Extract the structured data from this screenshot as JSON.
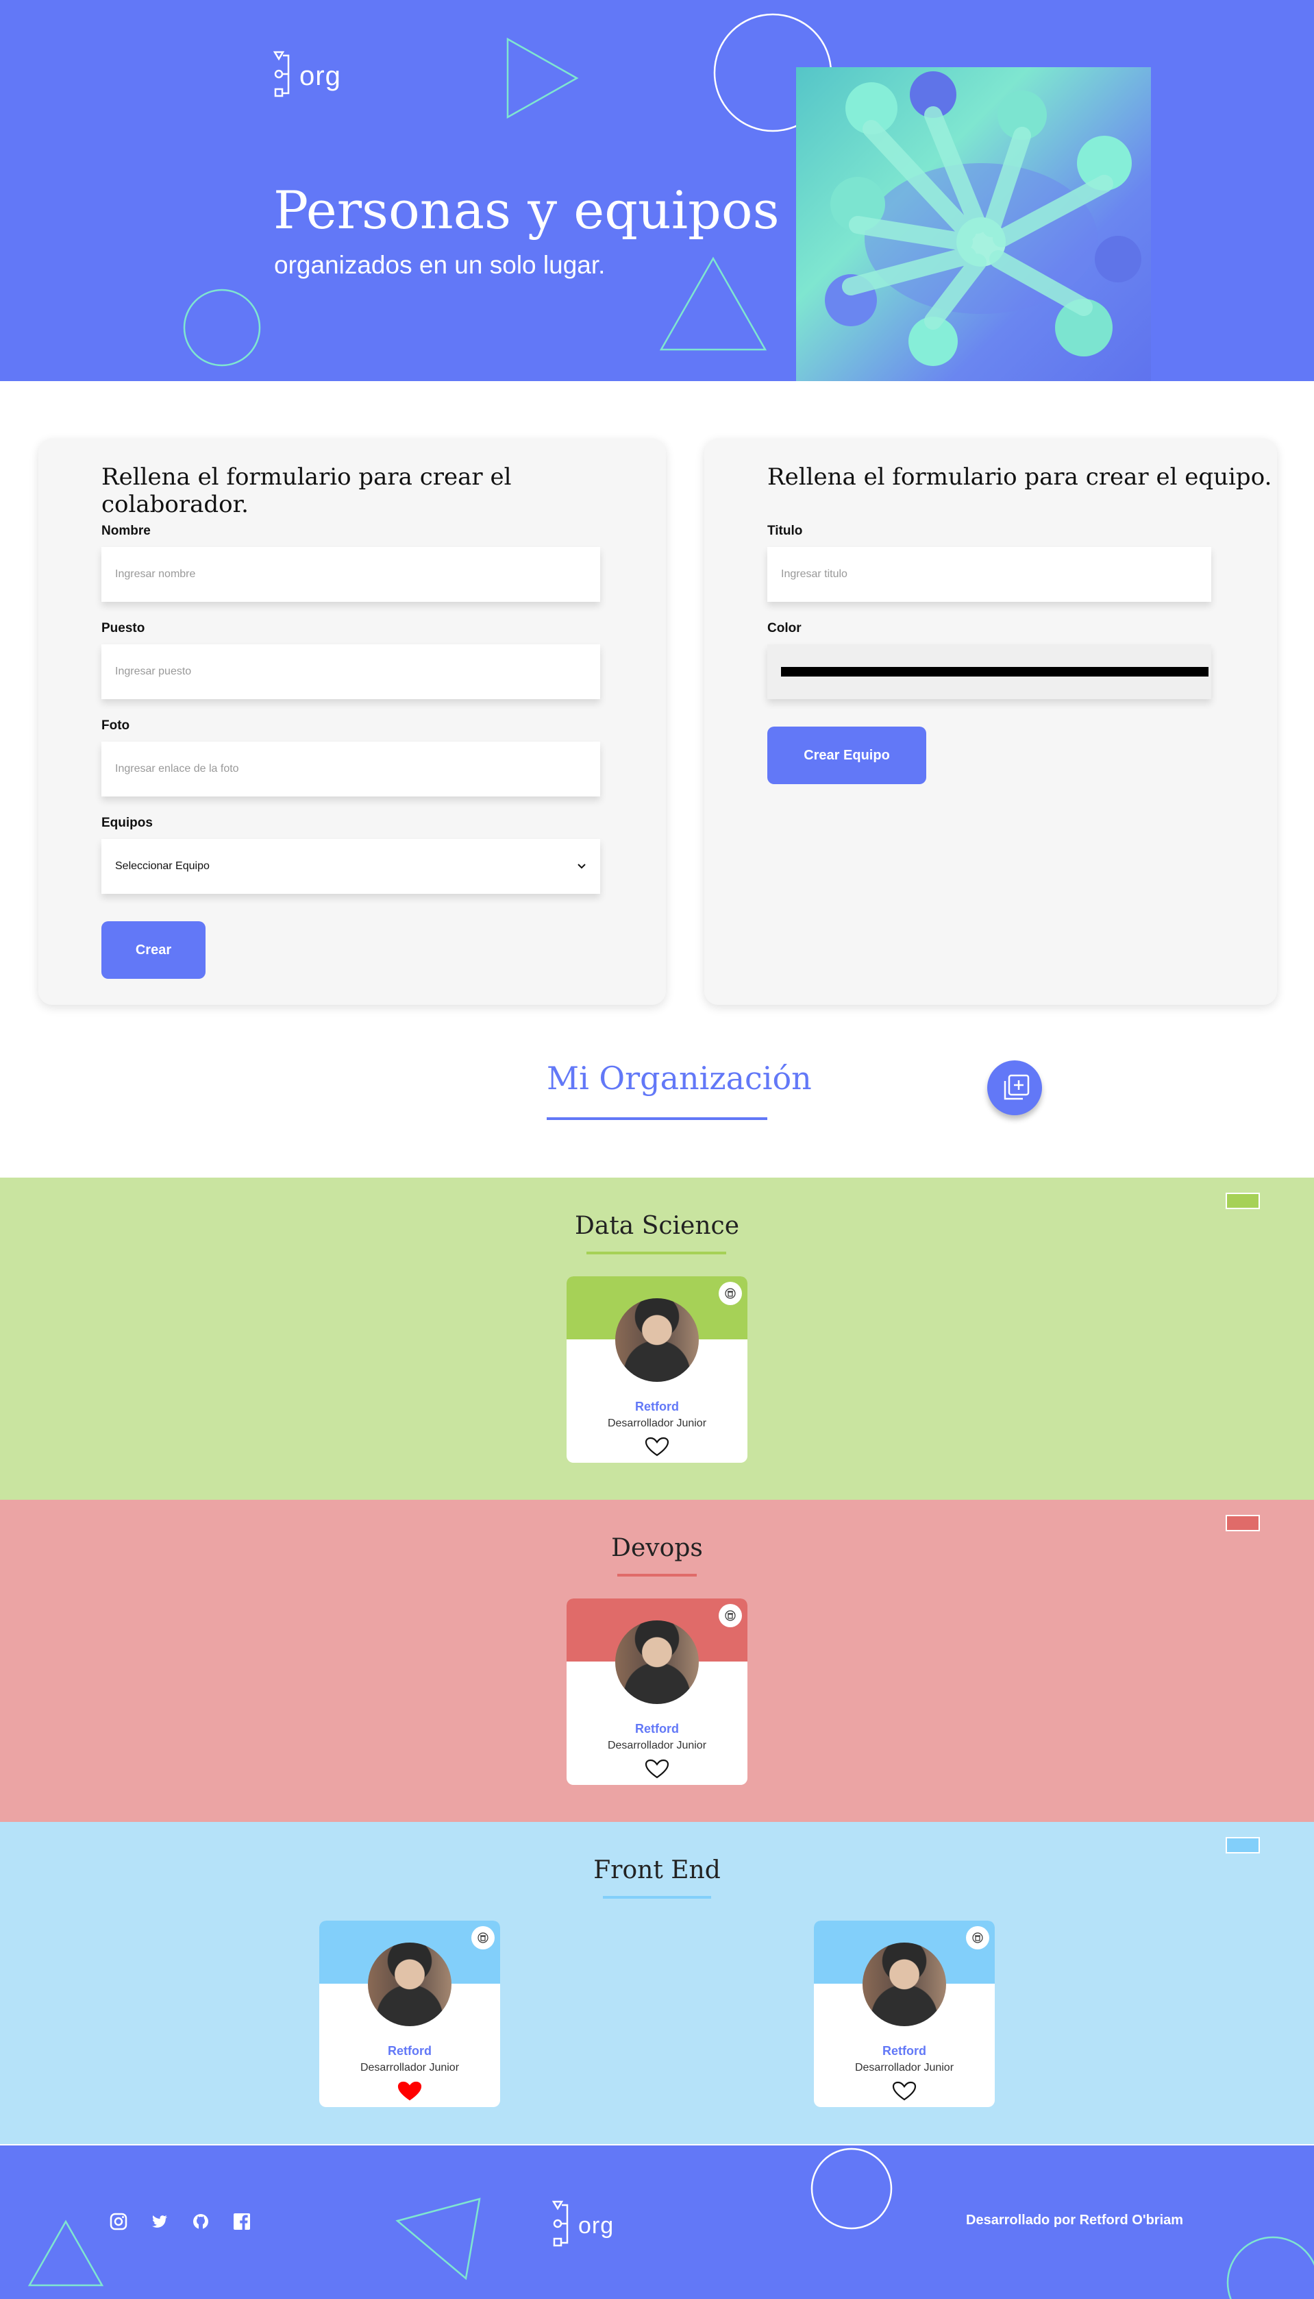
{
  "header": {
    "logo_text": "org",
    "hero_title": "Personas y equipos",
    "hero_subtitle": "organizados en un solo lugar."
  },
  "collaborator_form": {
    "heading": "Rellena el formulario para crear el colaborador.",
    "name_label": "Nombre",
    "name_placeholder": "Ingresar nombre",
    "role_label": "Puesto",
    "role_placeholder": "Ingresar puesto",
    "photo_label": "Foto",
    "photo_placeholder": "Ingresar enlace de la foto",
    "team_label": "Equipos",
    "team_selected": "Seleccionar Equipo",
    "submit_label": "Crear"
  },
  "team_form": {
    "heading": "Rellena el formulario para crear el equipo.",
    "title_label": "Titulo",
    "title_placeholder": "Ingresar titulo",
    "color_label": "Color",
    "color_value": "#000000",
    "submit_label": "Crear Equipo"
  },
  "organization": {
    "title": "Mi Organización",
    "add_icon": "add-layers-icon"
  },
  "teams": [
    {
      "title": "Data Science",
      "bg_color": "#c9e4a0",
      "primary_color": "#a6d157",
      "collaborators": [
        {
          "name": "Retford",
          "role": "Desarrollador Junior",
          "favorite": false
        }
      ]
    },
    {
      "title": "Devops",
      "bg_color": "#eba4a4",
      "primary_color": "#e06b69",
      "collaborators": [
        {
          "name": "Retford",
          "role": "Desarrollador Junior",
          "favorite": false
        }
      ]
    },
    {
      "title": "Front End",
      "bg_color": "#b5e2f9",
      "primary_color": "#82cffa",
      "collaborators": [
        {
          "name": "Retford",
          "role": "Desarrollador Junior",
          "favorite": true
        },
        {
          "name": "Retford",
          "role": "Desarrollador Junior",
          "favorite": false
        }
      ]
    }
  ],
  "footer": {
    "logo_text": "org",
    "social_icons": [
      "instagram-icon",
      "twitter-icon",
      "github-icon",
      "facebook-icon"
    ],
    "credits": "Desarrollado por Retford O'briam"
  },
  "colors": {
    "brand": "#6278f7",
    "deco_stroke": "#7fe6d0",
    "favorite": "#ff0000"
  }
}
